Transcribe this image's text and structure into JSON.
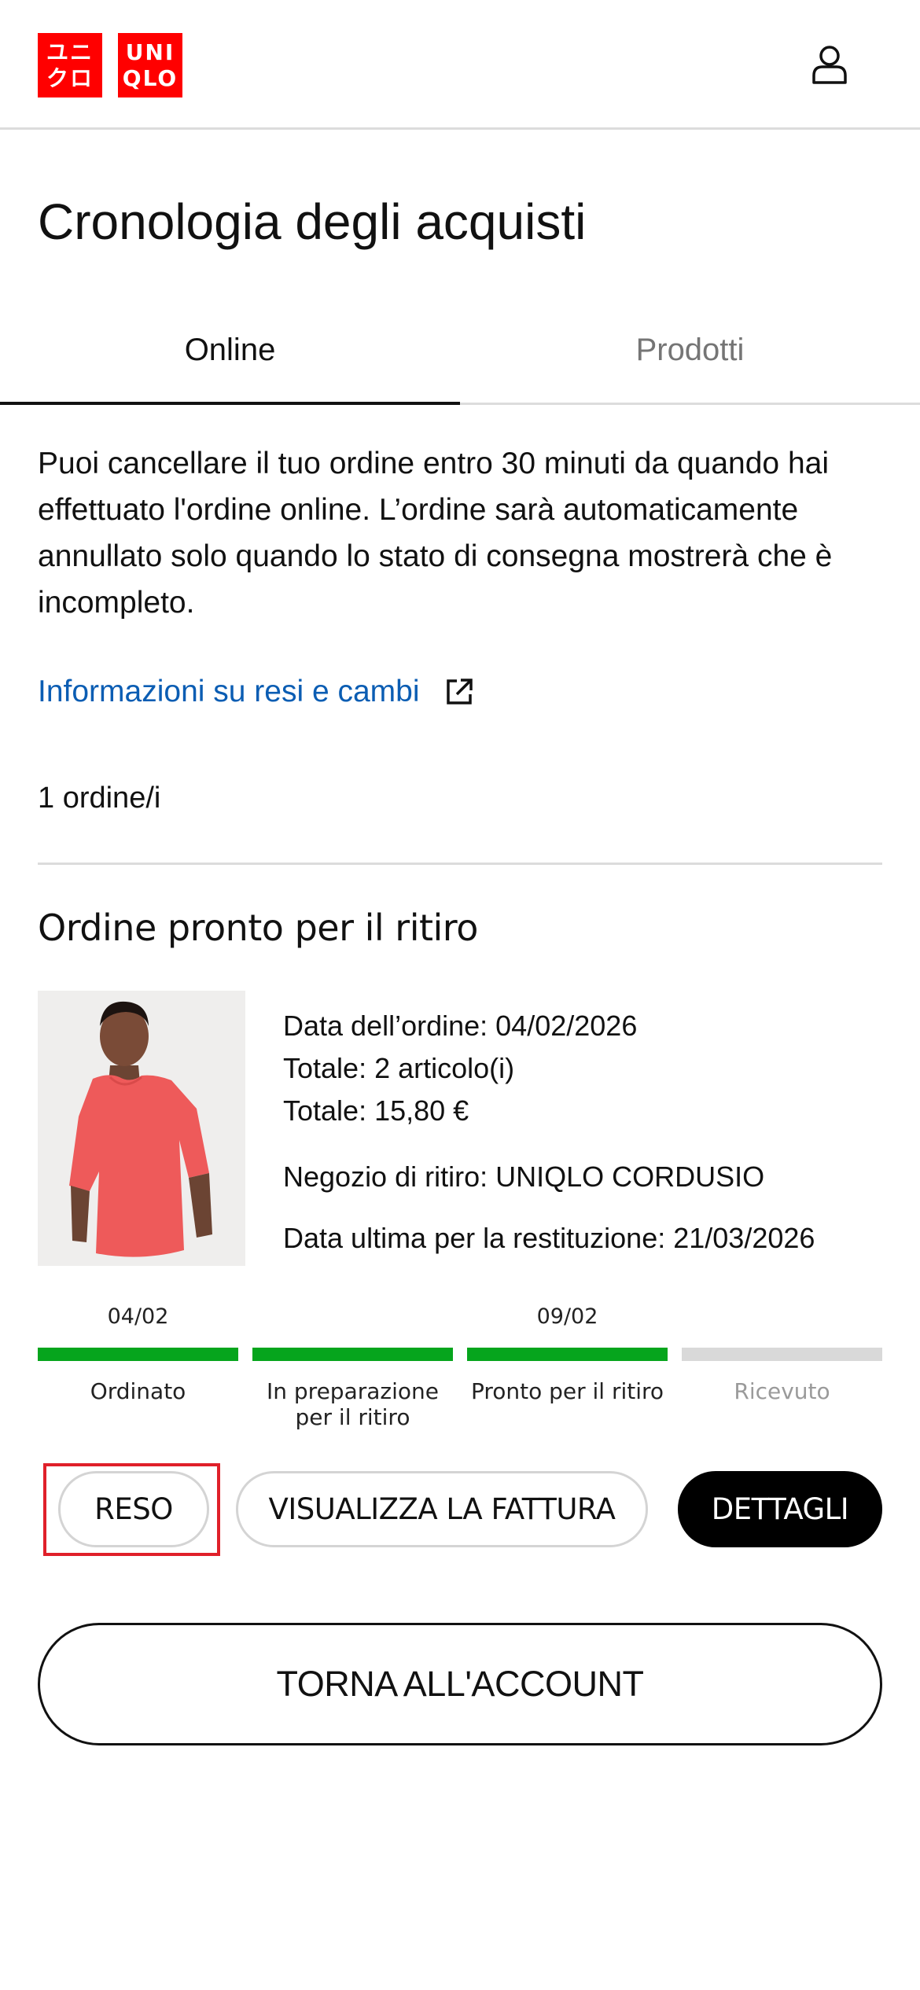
{
  "header": {
    "logo_top_left": "ユニ",
    "logo_bottom_left": "クロ",
    "logo_top_right": "UNI",
    "logo_bottom_right": "QLO",
    "account_icon": "user-icon"
  },
  "page": {
    "title": "Cronologia degli acquisti"
  },
  "tabs": [
    {
      "label": "Online",
      "active": true
    },
    {
      "label": "Prodotti",
      "active": false
    }
  ],
  "info": {
    "text": "Puoi cancellare il tuo ordine entro 30 minuti da quando hai effettuato l'ordine online. L’ordine sarà automaticamente annullato solo quando lo stato di consegna mostrerà che è incompleto.",
    "returns_link": "Informazioni su resi e cambi",
    "returns_link_icon": "external-link-icon"
  },
  "orders": {
    "count_label": "1 ordine/i"
  },
  "order": {
    "status_title": "Ordine pronto per il ritiro",
    "order_date": "Data dell’ordine: 04/02/2026",
    "items_total": "Totale: 2 articolo(i)",
    "price_total": "Totale: 15,80 €",
    "pickup_store": "Negozio di ritiro: UNIQLO CORDUSIO",
    "return_deadline": "Data ultima per la restituzione: 21/03/2026",
    "steps": [
      {
        "date": "04/02",
        "label": "Ordinato",
        "done": true
      },
      {
        "date": "",
        "label": "In preparazione per il ritiro",
        "done": true
      },
      {
        "date": "09/02",
        "label": "Pronto per il ritiro",
        "done": true
      },
      {
        "date": "",
        "label": "Ricevuto",
        "done": false
      }
    ],
    "buttons": {
      "return": "RESO",
      "invoice": "VISUALIZZA LA FATTURA",
      "details": "DETTAGLI"
    }
  },
  "footer": {
    "back_to_account": "TORNA ALL'ACCOUNT"
  },
  "colors": {
    "brand_red": "#ff0000",
    "progress_done": "#06a51d",
    "progress_pending": "#d9d9d9",
    "link_blue": "#0b5db3",
    "highlight_red": "#e0202a"
  }
}
